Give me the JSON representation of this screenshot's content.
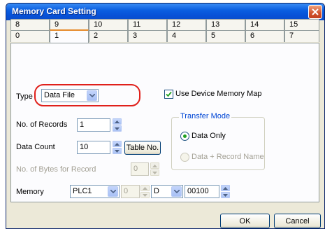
{
  "window": {
    "title": "Memory Card Setting"
  },
  "tabs": {
    "row1": [
      "8",
      "9",
      "10",
      "11",
      "12",
      "13",
      "14",
      "15"
    ],
    "row2": [
      "0",
      "1",
      "2",
      "3",
      "4",
      "5",
      "6",
      "7"
    ],
    "active": "1"
  },
  "form": {
    "type_label": "Type",
    "type_value": "Data File",
    "use_device_memory_map_label": "Use Device Memory Map",
    "use_device_memory_map_checked": true,
    "records_label": "No. of Records",
    "records_value": "1",
    "data_count_label": "Data Count",
    "data_count_value": "10",
    "table_no_button": "Table No.",
    "bytes_label": "No. of Bytes for Record",
    "bytes_value": "0",
    "memory_label": "Memory",
    "memory_plc": "PLC1",
    "memory_station": "0",
    "memory_device": "D",
    "memory_address": "00100"
  },
  "transfer_mode": {
    "title": "Transfer Mode",
    "option_data_only": "Data Only",
    "option_data_record": "Data + Record Name",
    "selected": "Data Only"
  },
  "buttons": {
    "ok": "OK",
    "cancel": "Cancel"
  },
  "colors": {
    "title_bar": "#0a5ee0",
    "highlight": "#e0201b",
    "active_tab_accent": "#e68b2c"
  }
}
